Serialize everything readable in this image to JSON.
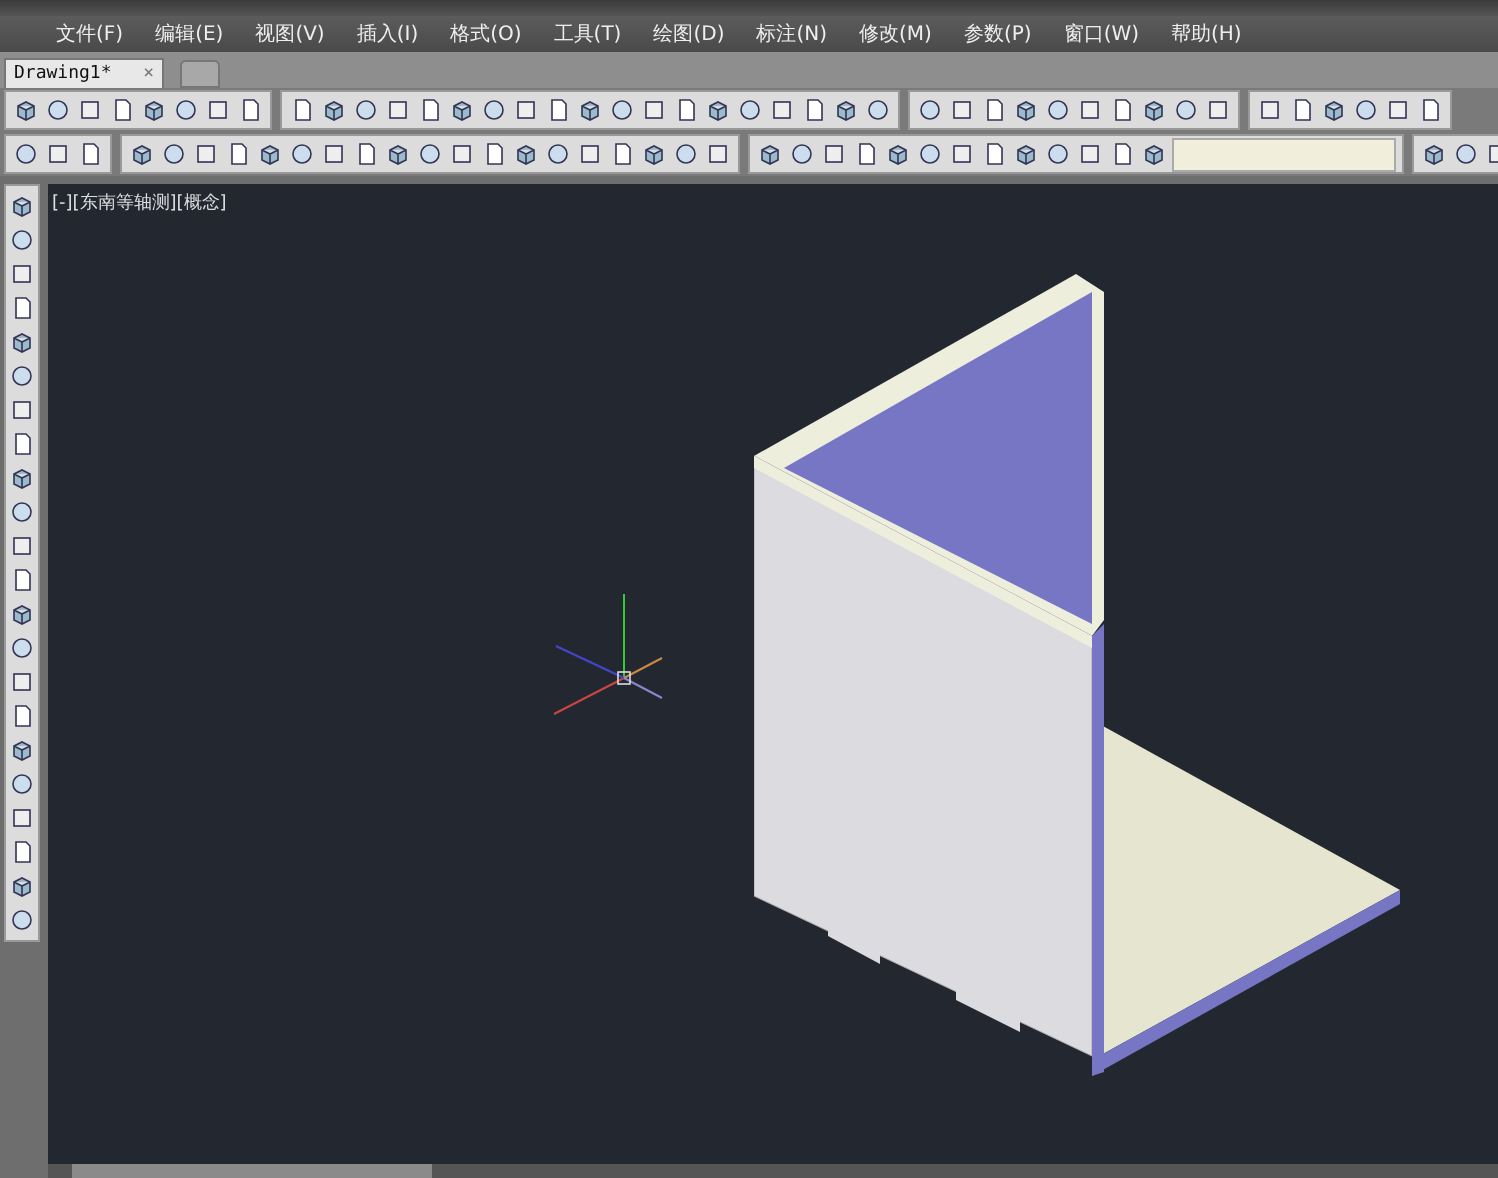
{
  "menu": [
    {
      "label": "文件(F)"
    },
    {
      "label": "编辑(E)"
    },
    {
      "label": "视图(V)"
    },
    {
      "label": "插入(I)"
    },
    {
      "label": "格式(O)"
    },
    {
      "label": "工具(T)"
    },
    {
      "label": "绘图(D)"
    },
    {
      "label": "标注(N)"
    },
    {
      "label": "修改(M)"
    },
    {
      "label": "参数(P)"
    },
    {
      "label": "窗口(W)"
    },
    {
      "label": "帮助(H)"
    }
  ],
  "tabs": [
    {
      "label": "Drawing1*",
      "close": "×",
      "selected": true
    }
  ],
  "viewport": {
    "label": "[-][东南等轴测][概念]"
  }
}
